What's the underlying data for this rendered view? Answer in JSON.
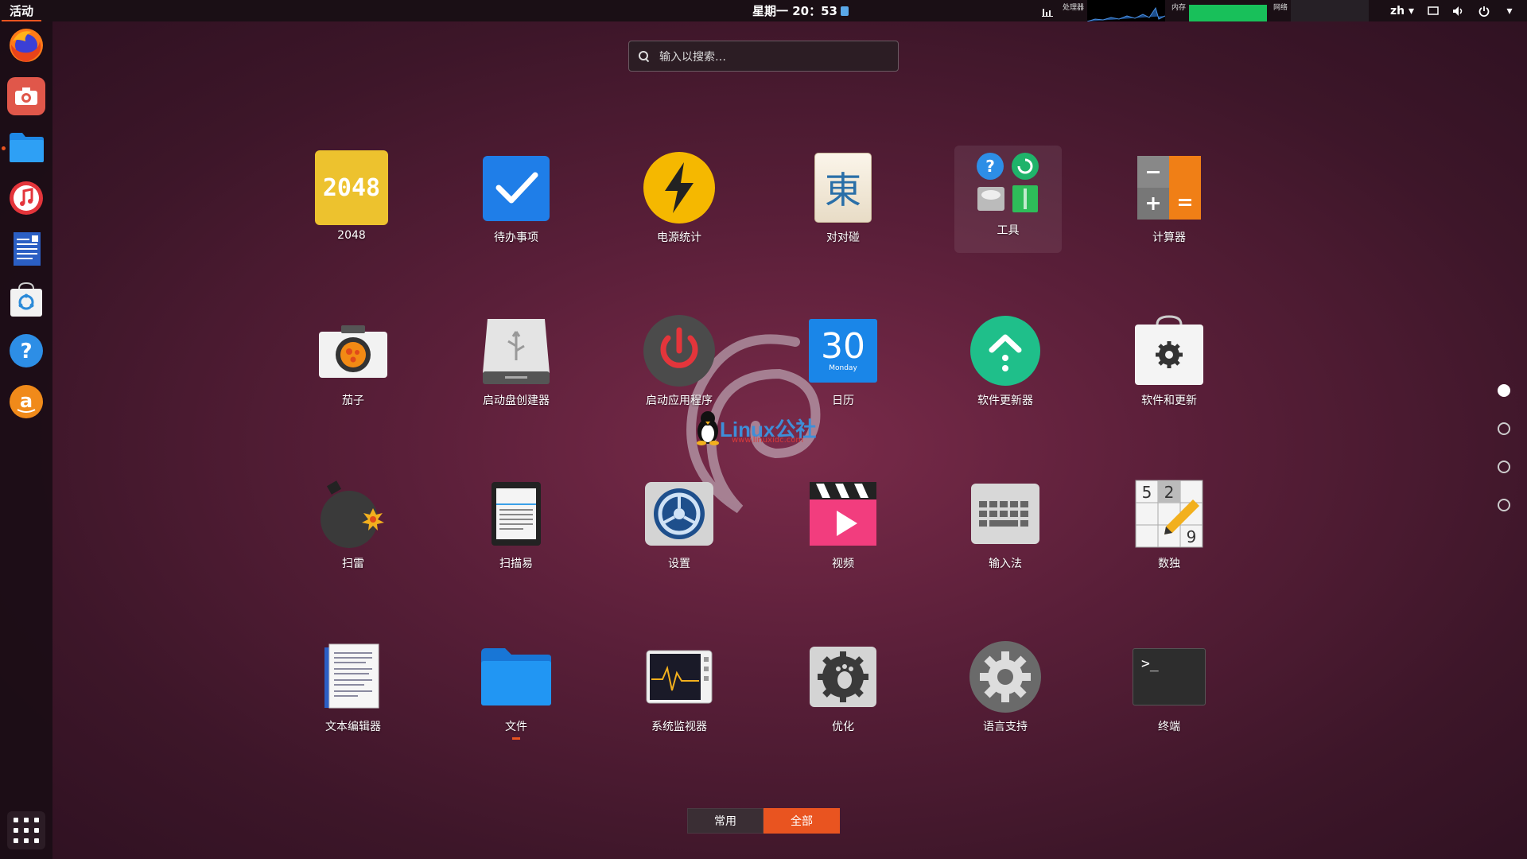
{
  "topbar": {
    "activities": "活动",
    "clock": "星期一 20：53",
    "monitors": {
      "cpu_label": "处理器",
      "mem_label": "内存",
      "net_label": "网络"
    },
    "lang": "zh"
  },
  "search": {
    "placeholder": "输入以搜索…"
  },
  "dock": {
    "items": [
      "firefox-icon",
      "screenshot-icon",
      "files-icon",
      "music-icon",
      "writer-icon",
      "software-icon",
      "help-icon",
      "amazon-icon"
    ],
    "show_apps": "show-apps-icon"
  },
  "apps": [
    {
      "label": "2048",
      "icon_text": "2048"
    },
    {
      "label": "待办事项"
    },
    {
      "label": "电源统计"
    },
    {
      "label": "对对碰",
      "icon_text": "東"
    },
    {
      "label": "工具"
    },
    {
      "label": "计算器"
    },
    {
      "label": "茄子"
    },
    {
      "label": "启动盘创建器"
    },
    {
      "label": "启动应用程序"
    },
    {
      "label": "日历",
      "icon_text": "30",
      "icon_sub": "Monday"
    },
    {
      "label": "软件更新器"
    },
    {
      "label": "软件和更新"
    },
    {
      "label": "扫雷"
    },
    {
      "label": "扫描易"
    },
    {
      "label": "设置"
    },
    {
      "label": "视频"
    },
    {
      "label": "输入法"
    },
    {
      "label": "数独"
    },
    {
      "label": "文本编辑器"
    },
    {
      "label": "文件"
    },
    {
      "label": "系统监视器"
    },
    {
      "label": "优化"
    },
    {
      "label": "语言支持"
    },
    {
      "label": "终端",
      "icon_text": ">_"
    }
  ],
  "watermark": {
    "brand": "Linux公社",
    "url": "www.linuxidc.com"
  },
  "pages": {
    "current": 1,
    "total": 4
  },
  "switcher": {
    "frequent": "常用",
    "all": "全部",
    "selected": "全部"
  },
  "colors": {
    "accent": "#e95420"
  }
}
